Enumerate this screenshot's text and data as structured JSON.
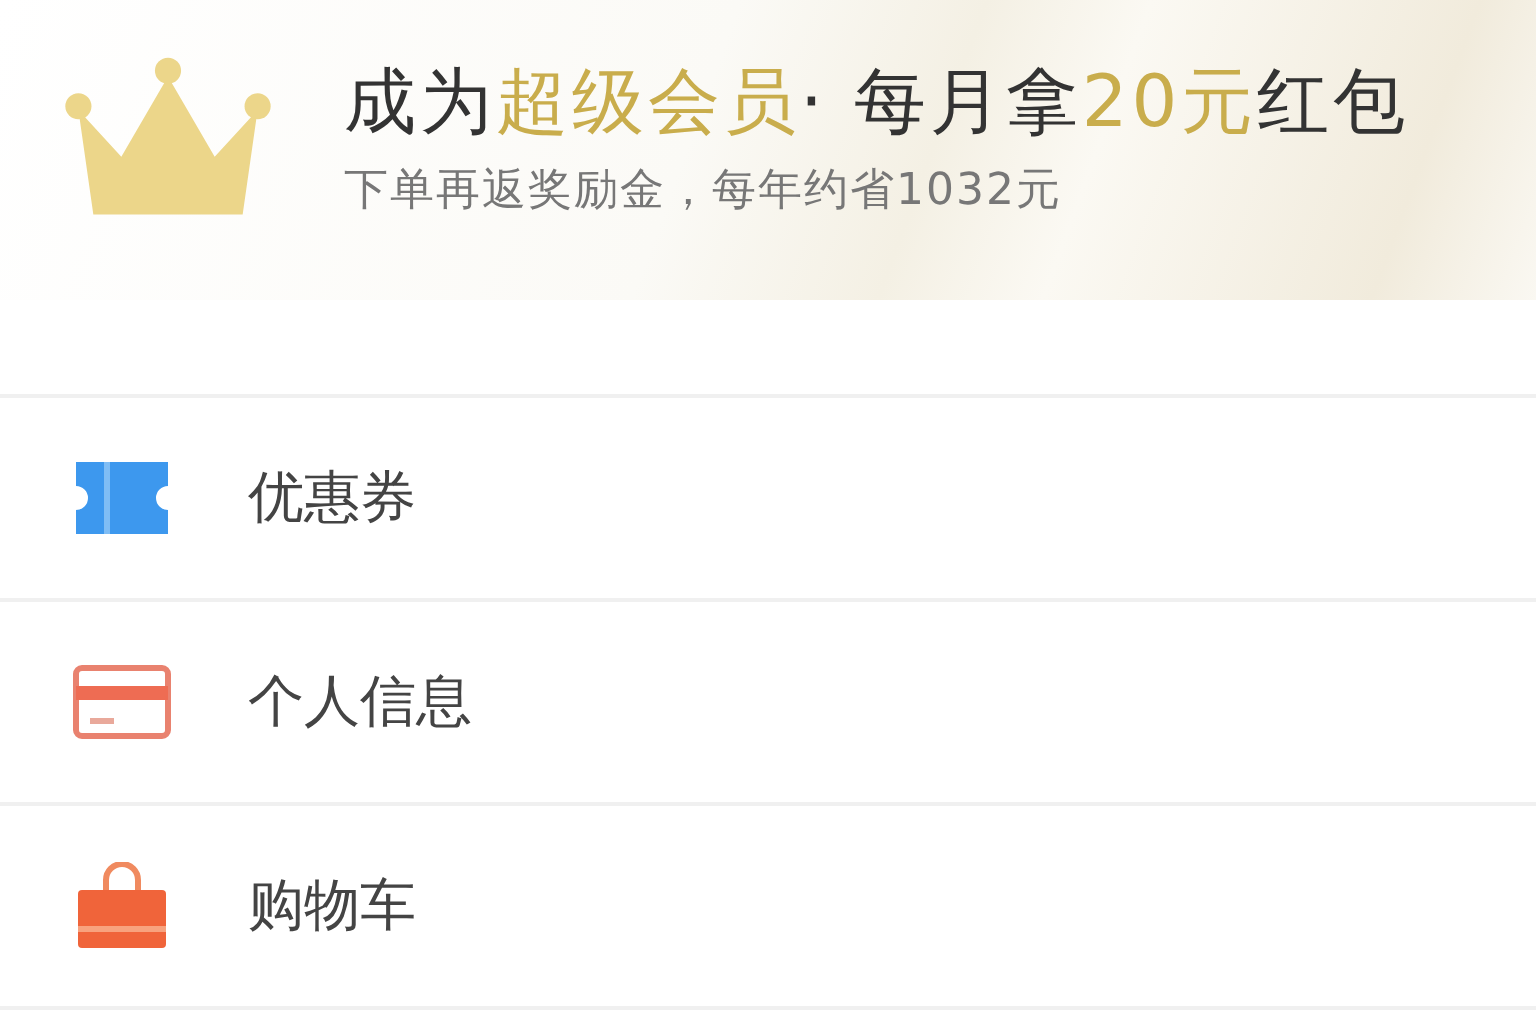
{
  "banner": {
    "title_parts": [
      {
        "text": "成为",
        "highlight": false
      },
      {
        "text": "超级会员",
        "highlight": true
      },
      {
        "text": "· 每月拿",
        "highlight": false
      },
      {
        "text": "20元",
        "highlight": true
      },
      {
        "text": "红包",
        "highlight": false
      }
    ],
    "subtitle": "下单再返奖励金，每年约省1032元"
  },
  "menu": [
    {
      "kind": "coupon",
      "label": "优惠券"
    },
    {
      "kind": "card",
      "label": "个人信息"
    },
    {
      "kind": "bag",
      "label": "购物车"
    }
  ]
}
